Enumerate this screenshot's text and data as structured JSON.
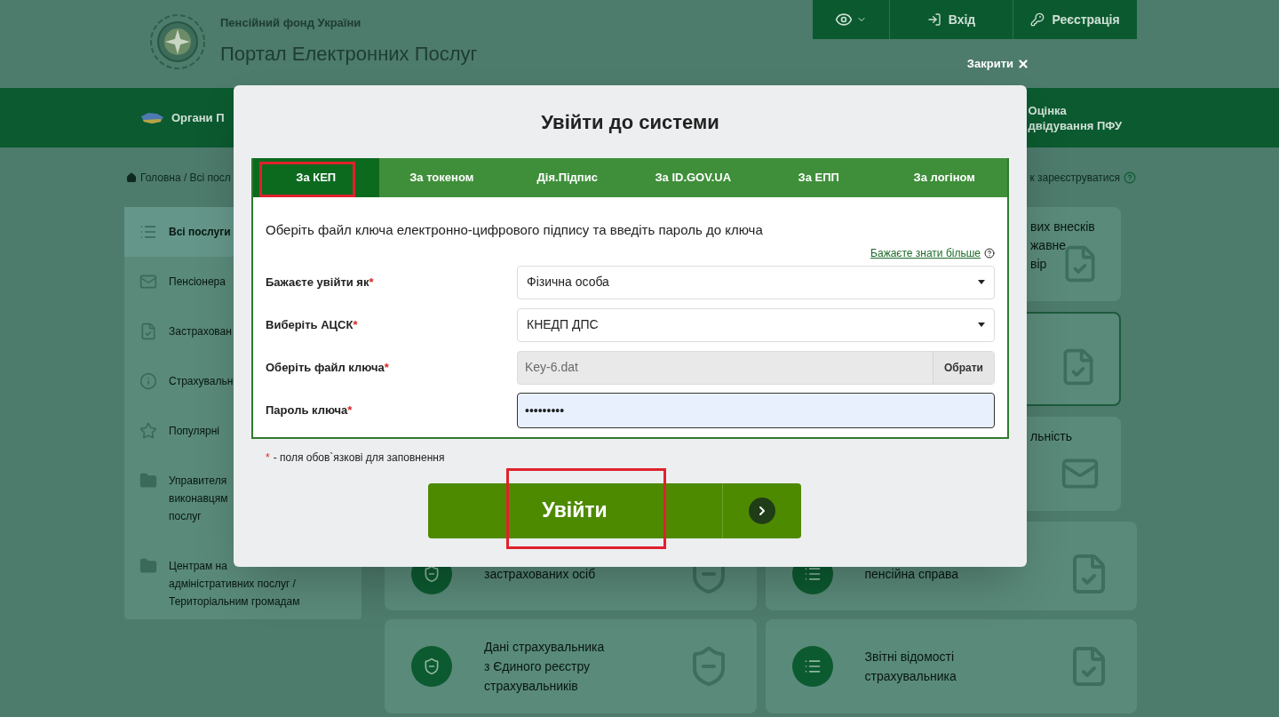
{
  "header": {
    "org_name": "Пенсійний фонд України",
    "portal_name": "Портал Електронних Послуг",
    "top_buttons": [
      {
        "kind": "login",
        "label": "Вхід"
      },
      {
        "kind": "register",
        "label": "Реєстрація"
      }
    ],
    "close_button": "Закрити"
  },
  "nav": {
    "items": [
      {
        "lines": [
          "Органи П"
        ]
      },
      {
        "lines": [
          "Оцінка",
          "двідування ПФУ"
        ]
      }
    ]
  },
  "breadcrumb": "Головна / Всі посл",
  "register_link": "к зареєструватися",
  "sidebar": {
    "items": [
      {
        "kind": "list",
        "lines": [
          "Всі послуги"
        ],
        "selected": true
      },
      {
        "kind": "mail",
        "lines": [
          "Пенсіонера"
        ],
        "selected": false
      },
      {
        "kind": "doc",
        "lines": [
          "Застрахован"
        ],
        "selected": false
      },
      {
        "kind": "info",
        "lines": [
          "Страхувальн"
        ],
        "selected": false
      },
      {
        "kind": "star",
        "lines": [
          "Популярні"
        ],
        "selected": false
      },
      {
        "kind": "folder",
        "lines": [
          "Управителя",
          "виконавцям",
          "послуг"
        ],
        "selected": false
      },
      {
        "kind": "folder",
        "lines": [
          "Центрам на",
          "адміністративних послуг /",
          "Територіальним громадам"
        ],
        "selected": false
      }
    ]
  },
  "service_cards": [
    {
      "kind": "doc",
      "lines": [
        "вих внесків",
        "жавне",
        "вір"
      ],
      "outlined": false
    },
    {
      "kind": "doc",
      "outlined": true
    },
    {
      "kind": "mail",
      "lines": [
        "льність"
      ],
      "outlined": false
    }
  ],
  "service_tiles": [
    {
      "kind": "shield",
      "lines": [
        "застрахованих осіб"
      ]
    },
    {
      "kind": "list",
      "lines": [
        "пенсійна справа"
      ]
    },
    {
      "kind": "shield",
      "lines": [
        "Дані страхувальника",
        "з Єдиного реєстру",
        "страхувальників"
      ]
    },
    {
      "kind": "list",
      "lines": [
        "Звітні відомості",
        "страхувальника"
      ]
    }
  ],
  "modal": {
    "title": "Увійти до системи",
    "tabs": [
      {
        "label": "За КЕП",
        "selected": true,
        "highlighted": true
      },
      {
        "label": "За токеном",
        "selected": false,
        "highlighted": false
      },
      {
        "label": "Дія.Підпис",
        "selected": false,
        "highlighted": false
      },
      {
        "label": "За ID.GOV.UA",
        "selected": false,
        "highlighted": false
      },
      {
        "label": "За ЕПП",
        "selected": false,
        "highlighted": false
      },
      {
        "label": "За логіном",
        "selected": false,
        "highlighted": false
      }
    ],
    "instruction": "Оберіть файл ключа електронно-цифрового підпису та введіть пароль до ключа",
    "more_link": "Бажаєте знати більше",
    "fields": [
      {
        "kind": "select",
        "label": "Бажаєте увійти як",
        "required_mark": "*",
        "value": "Фізична особа"
      },
      {
        "kind": "select",
        "label": "Виберіть АЦСК",
        "required_mark": "*",
        "value": "КНЕДП ДПС"
      },
      {
        "kind": "file",
        "label": "Оберіть файл ключа",
        "required_mark": "*",
        "value": "Key-6.dat",
        "button": "Обрати"
      },
      {
        "kind": "password",
        "label": "Пароль ключа",
        "required_mark": "*",
        "value": "•••••••••",
        "focused": true
      }
    ],
    "note": {
      "mark": "*",
      "text": "- поля обов`язкові для заповнення"
    },
    "submit": {
      "label": "Увійти",
      "highlighted": true
    }
  }
}
